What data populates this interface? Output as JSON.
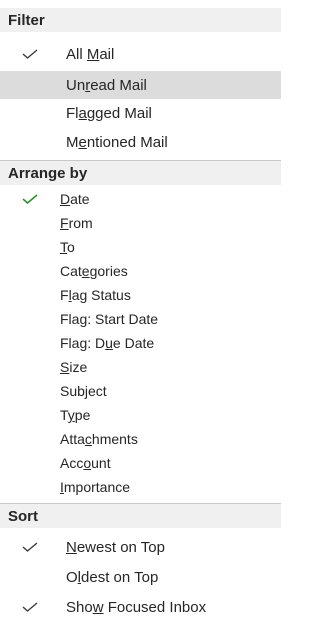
{
  "filter": {
    "header": "Filter",
    "items": [
      {
        "pre": "All ",
        "ul": "M",
        "post": "ail"
      },
      {
        "pre": "Un",
        "ul": "r",
        "post": "ead Mail"
      },
      {
        "pre": "Fl",
        "ul": "a",
        "post": "gged Mail"
      },
      {
        "pre": "M",
        "ul": "e",
        "post": "ntioned Mail"
      }
    ]
  },
  "arrange": {
    "header": "Arrange by",
    "items": [
      {
        "pre": "",
        "ul": "D",
        "post": "ate"
      },
      {
        "pre": "",
        "ul": "F",
        "post": "rom"
      },
      {
        "pre": "",
        "ul": "T",
        "post": "o"
      },
      {
        "pre": "Cat",
        "ul": "e",
        "post": "gories"
      },
      {
        "pre": "F",
        "ul": "l",
        "post": "ag Status"
      },
      {
        "pre": "Fla",
        "ul": "g",
        "post": ": Start Date"
      },
      {
        "pre": "Flag: D",
        "ul": "u",
        "post": "e Date"
      },
      {
        "pre": "",
        "ul": "S",
        "post": "ize"
      },
      {
        "pre": "Subject",
        "ul": "",
        "post": ""
      },
      {
        "pre": "T",
        "ul": "y",
        "post": "pe"
      },
      {
        "pre": "Atta",
        "ul": "c",
        "post": "hments"
      },
      {
        "pre": "Acc",
        "ul": "o",
        "post": "unt"
      },
      {
        "pre": "",
        "ul": "I",
        "post": "mportance"
      }
    ]
  },
  "sort": {
    "header": "Sort",
    "items": [
      {
        "pre": "",
        "ul": "N",
        "post": "ewest on Top"
      },
      {
        "pre": "O",
        "ul": "l",
        "post": "dest on Top"
      }
    ]
  },
  "focused": {
    "pre": "Sho",
    "ul": "w",
    "post": " Focused Inbox"
  },
  "colors": {
    "check_dark": "#3a3a3a",
    "check_green": "#2f8f2f",
    "hover": "#dcdcdc",
    "header_bg": "#f0f0f0"
  },
  "icons": {
    "filter_checked": "checkmark-icon",
    "arrange_checked": "checkmark-icon-green",
    "sort_checked": "checkmark-icon",
    "focused_checked": "checkmark-icon"
  }
}
